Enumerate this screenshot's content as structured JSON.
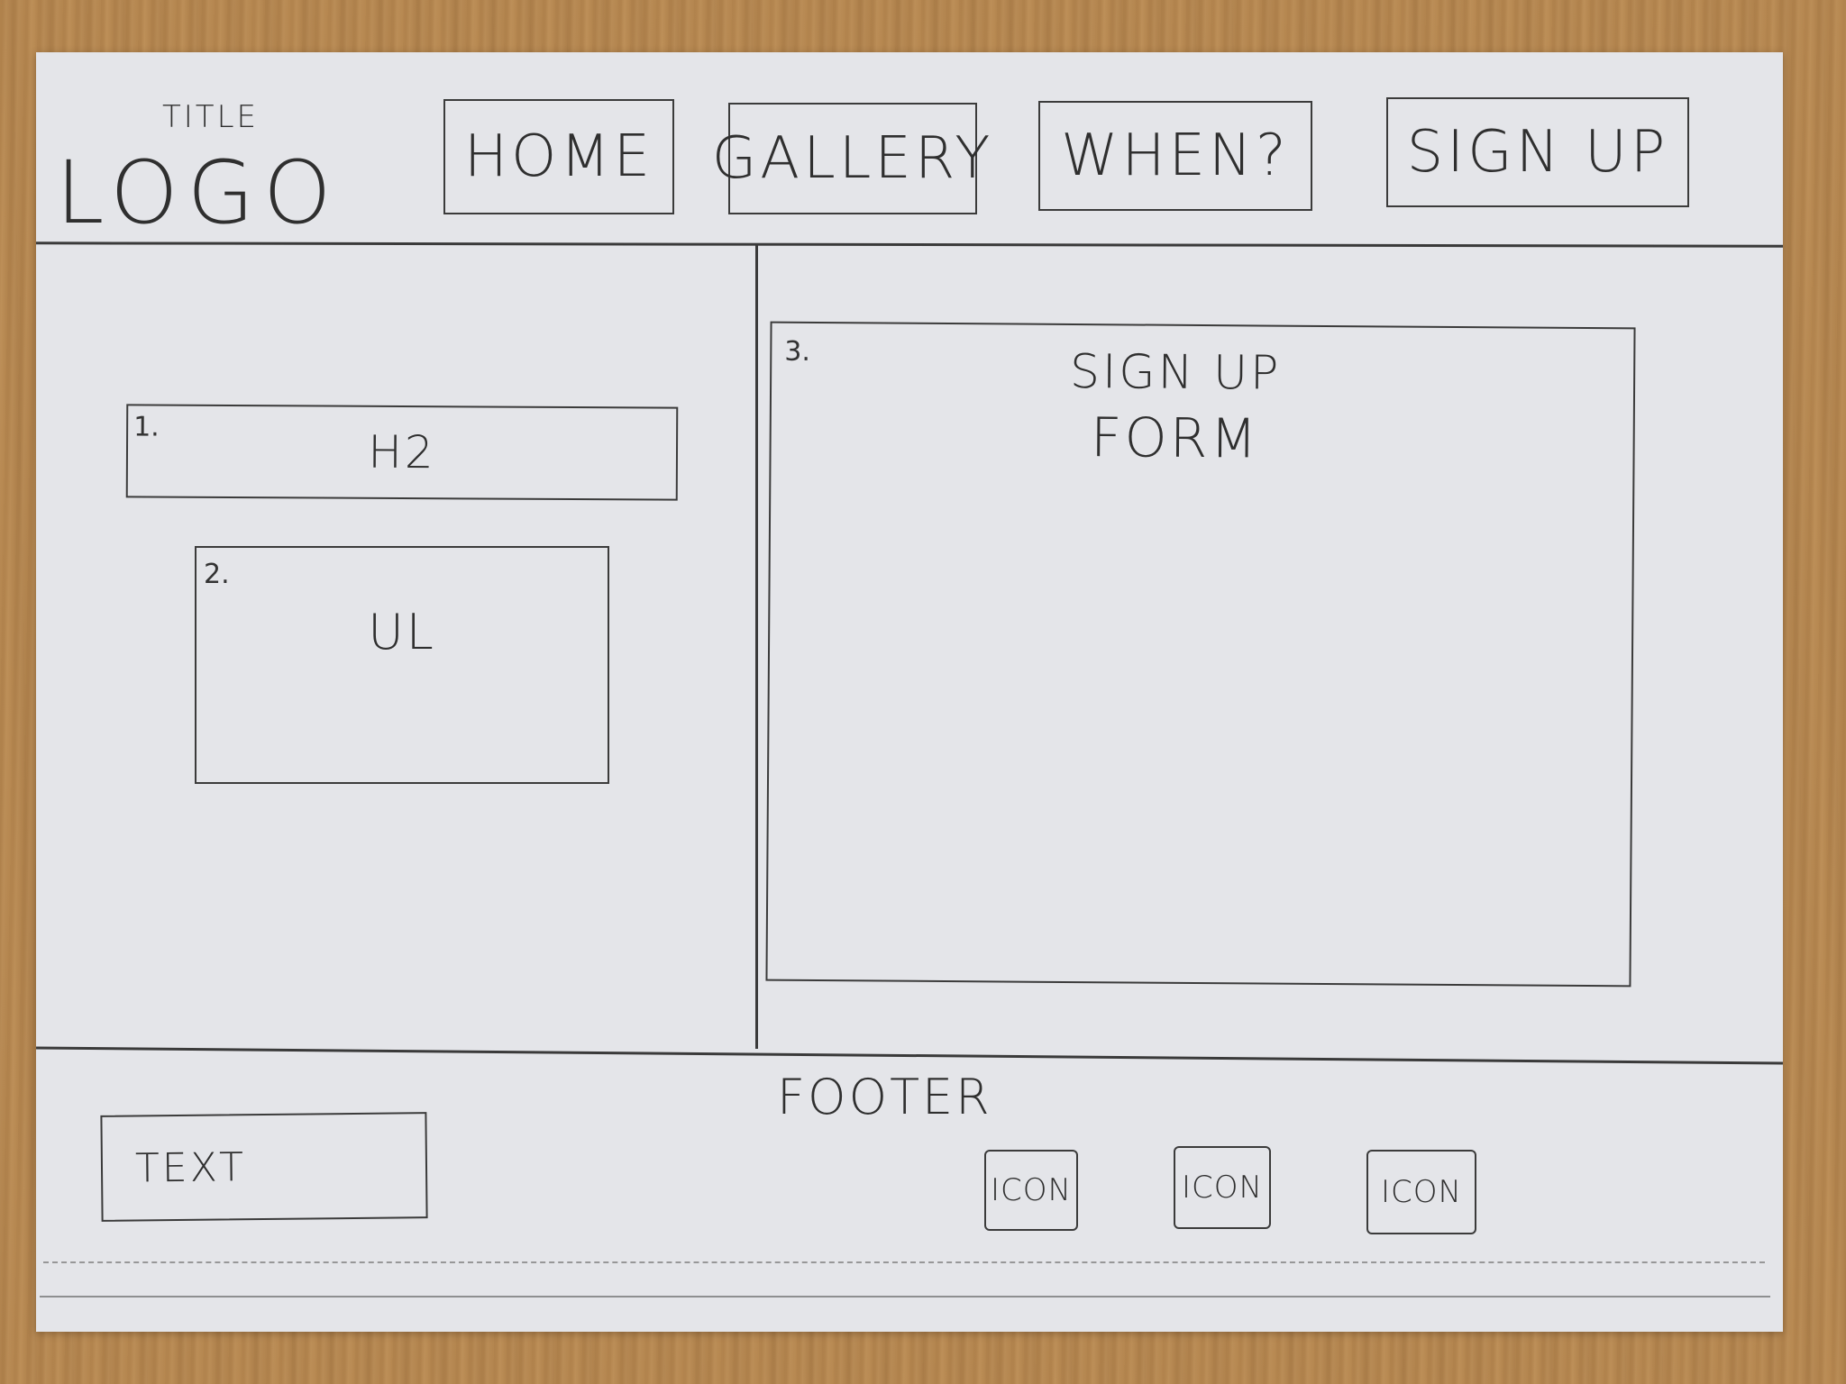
{
  "header": {
    "title": "TITLE",
    "logo": "LOGO",
    "nav": [
      {
        "label": "HOME"
      },
      {
        "label": "GALLERY"
      },
      {
        "label": "WHEN?"
      },
      {
        "label": "SIGN UP"
      }
    ]
  },
  "left": {
    "h2_box": {
      "number": "1.",
      "label": "H2"
    },
    "ul_box": {
      "number": "2.",
      "label": "UL"
    }
  },
  "right": {
    "form_box": {
      "number": "3.",
      "label_line1": "SIGN UP",
      "label_line2": "FORM"
    }
  },
  "footer": {
    "label": "FOOTER",
    "text_box": "TEXT",
    "icons": [
      {
        "label": "ICON",
        "icon": "generic-icon"
      },
      {
        "label": "ICON",
        "icon": "generic-icon"
      },
      {
        "label": "ICON",
        "icon": "generic-icon"
      }
    ]
  }
}
